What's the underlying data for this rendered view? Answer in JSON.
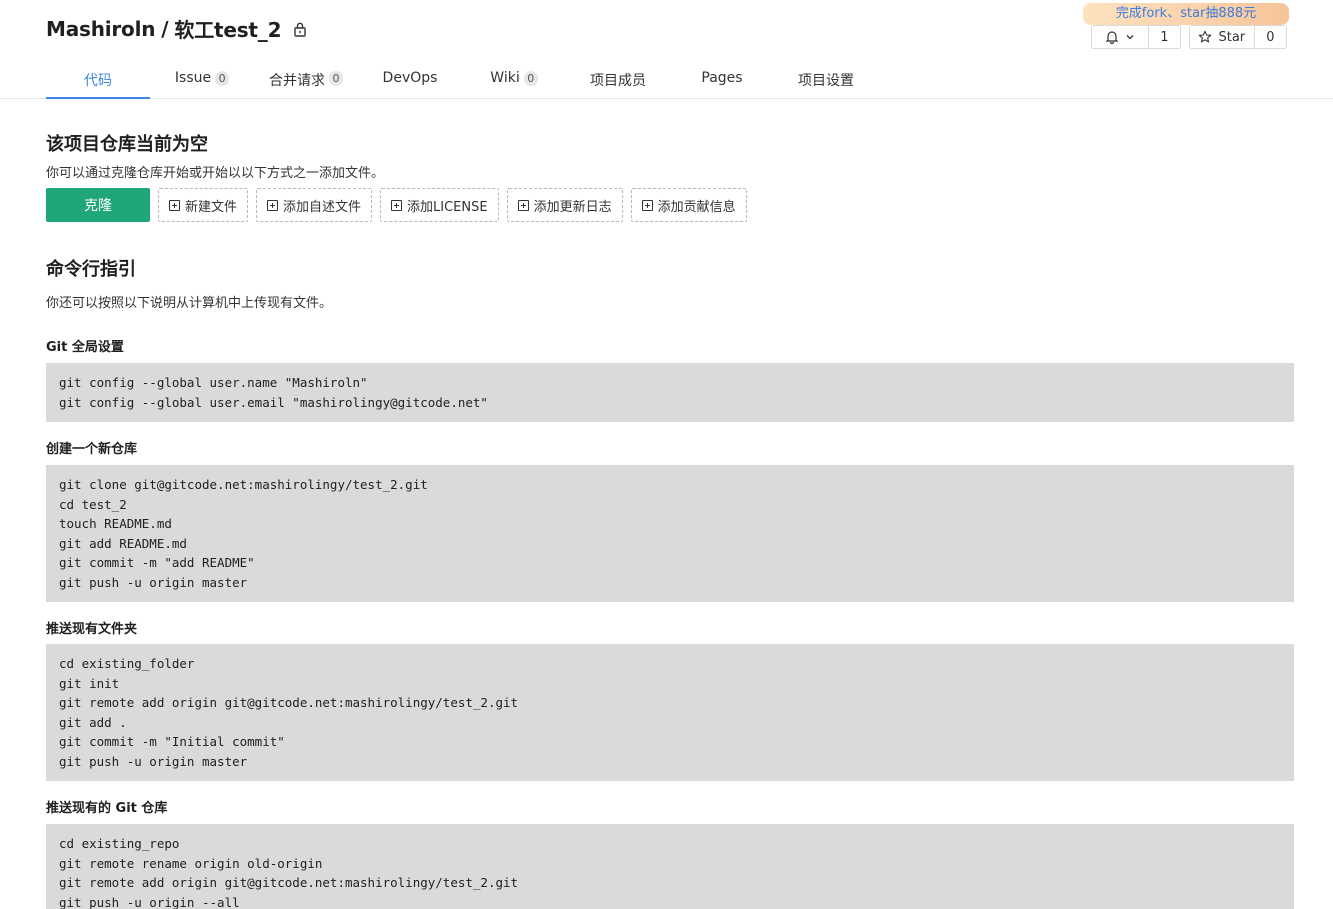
{
  "repo": {
    "owner": "Mashiroln",
    "separator": "/",
    "name": "软工test_2"
  },
  "promo": "完成fork、star抽888元",
  "watch": {
    "count": "1"
  },
  "star": {
    "label": "Star",
    "count": "0"
  },
  "tabs": [
    {
      "label": "代码",
      "badge": null,
      "active": true
    },
    {
      "label": "Issue",
      "badge": "0"
    },
    {
      "label": "合并请求",
      "badge": "0"
    },
    {
      "label": "DevOps",
      "badge": null
    },
    {
      "label": "Wiki",
      "badge": "0"
    },
    {
      "label": "项目成员",
      "badge": null
    },
    {
      "label": "Pages",
      "badge": null
    },
    {
      "label": "项目设置",
      "badge": null
    }
  ],
  "empty": {
    "title": "该项目仓库当前为空",
    "subtitle": "你可以通过克隆仓库开始或开始以以下方式之一添加文件。",
    "clone_label": "克隆",
    "actions": [
      "新建文件",
      "添加自述文件",
      "添加LICENSE",
      "添加更新日志",
      "添加贡献信息"
    ]
  },
  "cli": {
    "title": "命令行指引",
    "subtitle": "你还可以按照以下说明从计算机中上传现有文件。",
    "sections": [
      {
        "title": "Git 全局设置",
        "lines": [
          "git config --global user.name \"Mashiroln\"",
          "git config --global user.email \"mashirolingy@gitcode.net\""
        ]
      },
      {
        "title": "创建一个新仓库",
        "lines": [
          "git clone git@gitcode.net:mashirolingy/test_2.git",
          "cd test_2",
          "touch README.md",
          "git add README.md",
          "git commit -m \"add README\"",
          "git push -u origin master"
        ]
      },
      {
        "title": "推送现有文件夹",
        "lines": [
          "cd existing_folder",
          "git init",
          "git remote add origin git@gitcode.net:mashirolingy/test_2.git",
          "git add .",
          "git commit -m \"Initial commit\"",
          "git push -u origin master"
        ]
      },
      {
        "title": "推送现有的 Git 仓库",
        "lines": [
          "cd existing_repo",
          "git remote rename origin old-origin",
          "git remote add origin git@gitcode.net:mashirolingy/test_2.git",
          "git push -u origin --all"
        ]
      }
    ]
  },
  "colors": {
    "accent": "#3d86e6",
    "clone_button": "#1fa67a",
    "code_bg": "#dadada"
  }
}
